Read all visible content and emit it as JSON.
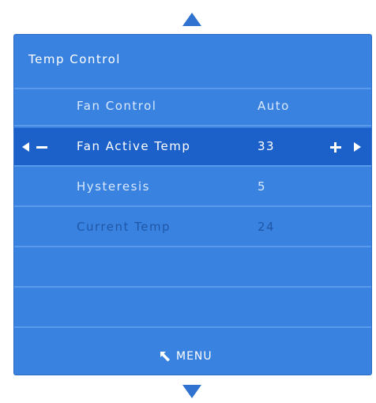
{
  "nav": {
    "up_icon": "triangle-up-icon",
    "down_icon": "triangle-down-icon"
  },
  "panel": {
    "title": "Temp Control",
    "rows": [
      {
        "label": "Fan Control",
        "value": "Auto"
      },
      {
        "label": "Fan Active Temp",
        "value": "33"
      },
      {
        "label": "Hysteresis",
        "value": "5"
      },
      {
        "label": "Current Temp",
        "value": "24"
      }
    ],
    "footer": {
      "menu_label": "MENU",
      "menu_icon": "return-arrow-icon"
    }
  },
  "colors": {
    "panel": "#3a82df",
    "selected_row": "#1c61c9",
    "divider": "#5a9aea",
    "dim_text": "#1f57a8",
    "arrow": "#2f72cf"
  }
}
